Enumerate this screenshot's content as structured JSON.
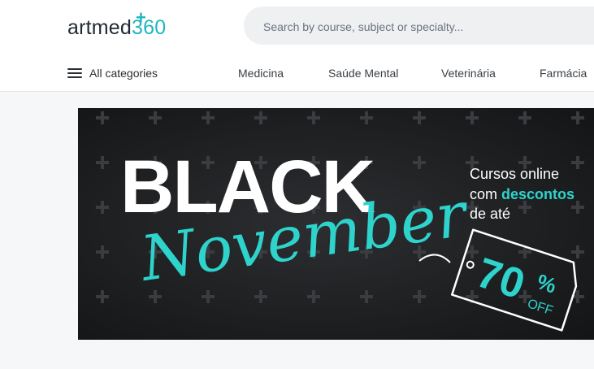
{
  "logo": {
    "wordmark": "artmed",
    "number": "360",
    "plus": "+"
  },
  "search": {
    "placeholder": "Search by course, subject or specialty..."
  },
  "nav": {
    "menu_label": "All categories",
    "items": [
      "Medicina",
      "Saúde Mental",
      "Veterinária",
      "Farmácia"
    ]
  },
  "banner": {
    "headline": "BLACK",
    "script": "November",
    "copy_line1": "Cursos online",
    "copy_line2_a": "com ",
    "copy_line2_b": "descontos",
    "copy_line3": "de até",
    "discount_value": "70",
    "discount_percent": "%",
    "discount_off": "OFF"
  },
  "colors": {
    "accent": "#21b5c0",
    "banner_bg": "#1b1c1e",
    "text_dark": "#1f2933"
  }
}
